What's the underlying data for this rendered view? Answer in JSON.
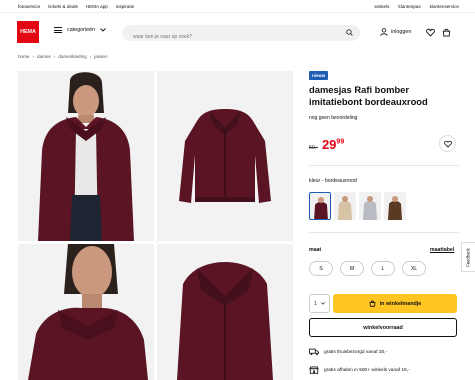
{
  "topbar": {
    "left": [
      "fotoservice",
      "tickets & deals",
      "HEMA app",
      "inspiratie"
    ],
    "right": [
      "winkels",
      "klantenpas",
      "klantenservice"
    ]
  },
  "header": {
    "logo": "HEMA",
    "categories_label": "categorieën",
    "search_placeholder": "waar ben je naar op zoek?",
    "login_label": "inloggen"
  },
  "breadcrumb": [
    "home",
    "dames",
    "dameskleding",
    "jassen"
  ],
  "product": {
    "badge": "nieuw",
    "title": "damesjas Rafi bomber imitatiebont bordeauxrood",
    "rating": "nog geen beoordeling",
    "old_price": "50,-",
    "price_main": "29",
    "price_cents": "99",
    "color_label": "kleur - bordeauxrood",
    "swatches": [
      "bordeauxrood",
      "beige",
      "grijs",
      "bruin"
    ],
    "size_label": "maat",
    "size_table": "maattabel",
    "sizes": [
      "S",
      "M",
      "L",
      "XL"
    ],
    "quantity": "1",
    "cart_label": "in winkelmandje",
    "reserve_label": "winkelvoorraad",
    "usp": [
      "gratis thuisbezorgd vanaf 30,-",
      "gratis afhalen in 500+ winkels vanaf 15,-"
    ]
  },
  "feedback_label": "Feedback",
  "colors": {
    "brand": "#e30613",
    "accent": "#ffc522",
    "badge": "#1e5fb4",
    "burgundy": "#5a1424"
  }
}
